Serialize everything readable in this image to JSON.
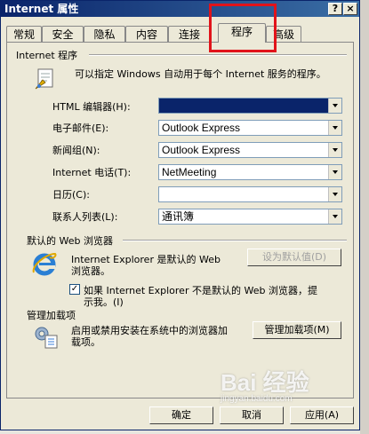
{
  "window": {
    "title": "Internet 属性",
    "help_label": "?",
    "close_label": "×"
  },
  "tabs": [
    {
      "label": "常规"
    },
    {
      "label": "安全"
    },
    {
      "label": "隐私"
    },
    {
      "label": "内容"
    },
    {
      "label": "连接"
    },
    {
      "label": "程序"
    },
    {
      "label": "高级"
    }
  ],
  "internet_programs": {
    "group_title": "Internet 程序",
    "description": "可以指定 Windows 自动用于每个 Internet 服务的程序。",
    "rows": [
      {
        "label": "HTML 编辑器(H):",
        "value": ""
      },
      {
        "label": "电子邮件(E):",
        "value": "Outlook Express"
      },
      {
        "label": "新闻组(N):",
        "value": "Outlook Express"
      },
      {
        "label": "Internet 电话(T):",
        "value": "NetMeeting"
      },
      {
        "label": "日历(C):",
        "value": ""
      },
      {
        "label": "联系人列表(L):",
        "value": "通讯簿"
      }
    ]
  },
  "default_browser": {
    "group_title": "默认的 Web 浏览器",
    "status_line1": "Internet Explorer 是默认的 Web",
    "status_line2": "浏览器。",
    "set_default_button": "设为默认值(D)",
    "check_label_line1": "如果 Internet Explorer 不是默认的 Web 浏览器，提",
    "check_label_line2": "示我。(I)",
    "check_mark": "✓"
  },
  "addons": {
    "group_title": "管理加载项",
    "description_line1": "启用或禁用安装在系统中的浏览器加",
    "description_line2": "载项。",
    "manage_button": "管理加载项(M)"
  },
  "footer": {
    "ok": "确定",
    "cancel": "取消",
    "apply": "应用(A)"
  },
  "watermark": {
    "text": "Bai 经验",
    "sub": "jingyan.baidu.com"
  },
  "colors": {
    "highlight_box": "#e1131a",
    "selection": "#0a246a"
  }
}
